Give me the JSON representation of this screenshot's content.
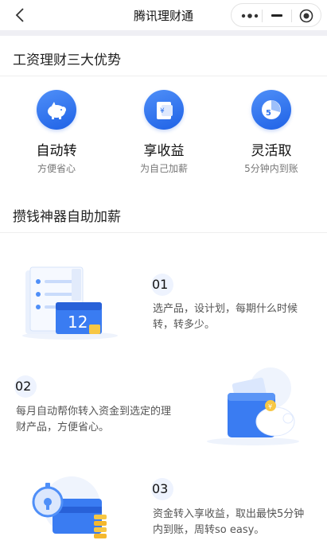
{
  "nav": {
    "title": "腾讯理财通",
    "back_icon": "chevron-left-icon",
    "capsule_icons": [
      "more-dots-icon",
      "minimize-icon",
      "close-target-icon"
    ]
  },
  "section1": {
    "title": "工资理财三大优势",
    "items": [
      {
        "name": "自动转",
        "desc": "方便省心",
        "icon": "piggy-bank-icon"
      },
      {
        "name": "享收益",
        "desc": "为自己加薪",
        "icon": "yen-bill-icon"
      },
      {
        "name": "灵活取",
        "desc": "5分钟内到账",
        "icon": "clock-5-icon"
      }
    ]
  },
  "section2": {
    "title": "攒钱神器自助加薪",
    "steps": [
      {
        "num": "01",
        "text": "选产品，设计划，每期什么时候转，转多少。",
        "illustration": "calendar-checklist-illustration",
        "calendar_day": "12"
      },
      {
        "num": "02",
        "text": "每月自动帮你转入资金到选定的理财产品，方便省心。",
        "illustration": "wallet-piggy-illustration"
      },
      {
        "num": "03",
        "text": "资金转入享收益，取出最快5分钟内到账，周转so easy。",
        "illustration": "stopwatch-card-illustration"
      }
    ]
  },
  "colors": {
    "accent": "#2f74f0",
    "background": "#ffffff",
    "band": "#efeff4"
  }
}
